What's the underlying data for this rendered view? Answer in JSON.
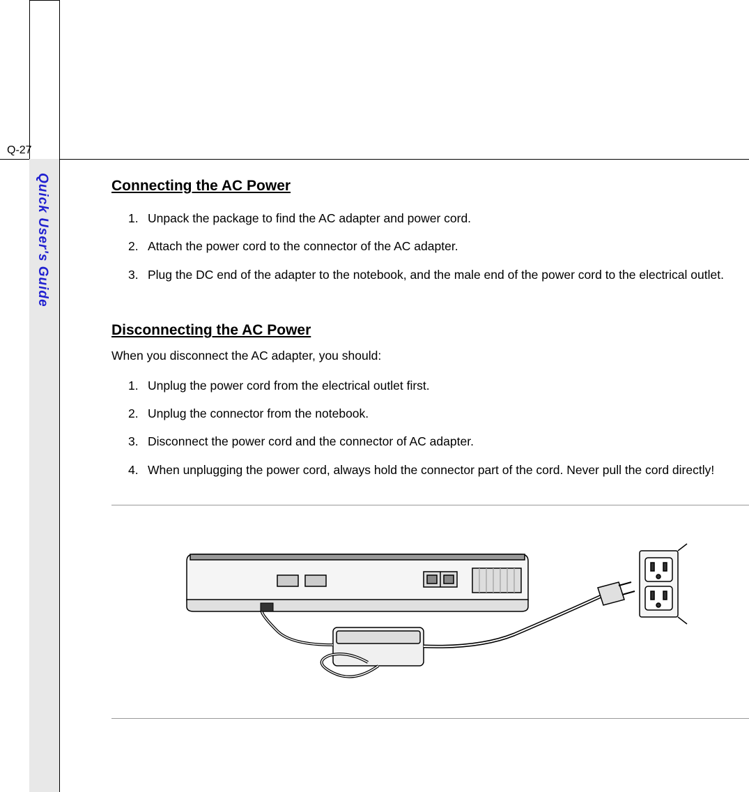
{
  "page_number": "Q-27",
  "sidebar_label": "Quick User's Guide",
  "section1": {
    "heading": "Connecting the AC Power",
    "steps": [
      "Unpack the package to find the AC adapter and power cord.",
      "Attach the power cord to the connector of the AC adapter.",
      "Plug the DC end of the adapter to the notebook, and the male end of the power cord to the electrical outlet."
    ]
  },
  "section2": {
    "heading": "Disconnecting the AC Power",
    "intro": "When you disconnect the AC adapter, you should:",
    "steps": [
      "Unplug the power cord from the electrical outlet first.",
      "Unplug the connector from the notebook.",
      "Disconnect the power cord and the connector of AC adapter.",
      "When unplugging the power cord, always hold the connector part of the cord. Never pull the cord directly!"
    ]
  }
}
